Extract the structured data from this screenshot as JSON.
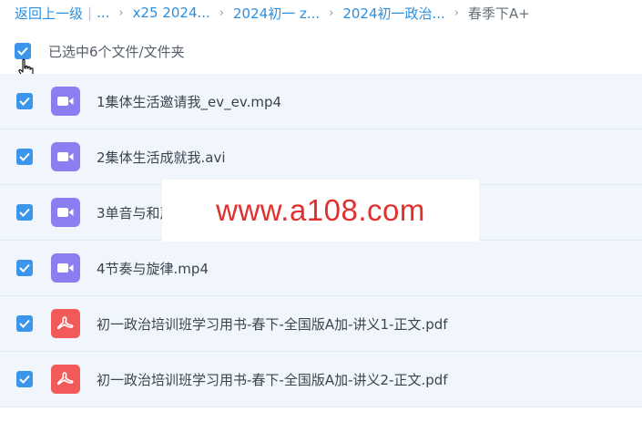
{
  "breadcrumb": {
    "back_label": "返回上一级",
    "separator": "|",
    "ellipsis": "...",
    "items": [
      "x25 2024...",
      "2024初一 z...",
      "2024初一政治..."
    ],
    "arrow": "›",
    "current": "春季下A+"
  },
  "selection": {
    "label": "已选中6个文件/文件夹",
    "checked": true
  },
  "files": [
    {
      "name": "1集体生活邀请我_ev_ev.mp4",
      "type": "video",
      "icon": "video-icon"
    },
    {
      "name": "2集体生活成就我.avi",
      "type": "video",
      "icon": "video-icon"
    },
    {
      "name": "3单音与和声.mp4",
      "type": "video",
      "icon": "video-icon"
    },
    {
      "name": "4节奏与旋律.mp4",
      "type": "video",
      "icon": "video-icon"
    },
    {
      "name": "初一政治培训班学习用书-春下-全国版A加-讲义1-正文.pdf",
      "type": "pdf",
      "icon": "pdf-icon"
    },
    {
      "name": "初一政治培训班学习用书-春下-全国版A加-讲义2-正文.pdf",
      "type": "pdf",
      "icon": "pdf-icon"
    }
  ],
  "watermark": {
    "text": "www.a108.com",
    "color": "#e0312f"
  },
  "colors": {
    "link": "#2a8fe0",
    "checkbox": "#3b95ea",
    "row_bg": "#f1f6fc",
    "video_icon": "#8b7df2",
    "pdf_icon": "#f25a5a"
  }
}
